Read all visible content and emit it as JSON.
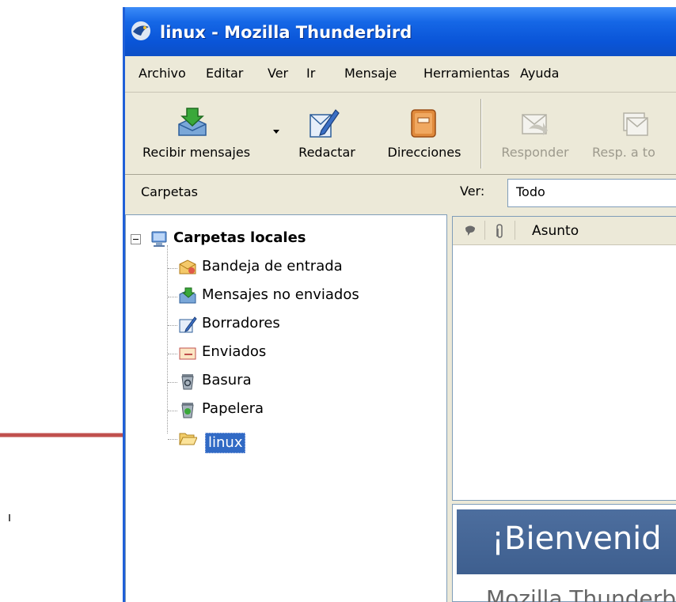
{
  "window": {
    "title": "linux - Mozilla Thunderbird"
  },
  "menu": [
    "Archivo",
    "Editar",
    "Ver",
    "Ir",
    "Mensaje",
    "Herramientas",
    "Ayuda"
  ],
  "toolbar": {
    "get_mail": "Recibir mensajes",
    "compose": "Redactar",
    "address_book": "Direcciones",
    "reply": "Responder",
    "reply_all": "Resp. a to"
  },
  "folder_pane": {
    "header": "Carpetas",
    "account": "Carpetas locales",
    "folders": [
      "Bandeja de entrada",
      "Mensajes no enviados",
      "Borradores",
      "Enviados",
      "Basura",
      "Papelera",
      "linux"
    ]
  },
  "view": {
    "label": "Ver:",
    "value": "Todo"
  },
  "thread_pane": {
    "subject_header": "Asunto"
  },
  "message_pane": {
    "banner": "¡Bienvenid",
    "body_fragment": "Mozilla Thunderbird"
  },
  "colors": {
    "title_bar": "#0a55d8",
    "selection": "#316ac5",
    "annotation_arrow": "#c0504d"
  }
}
